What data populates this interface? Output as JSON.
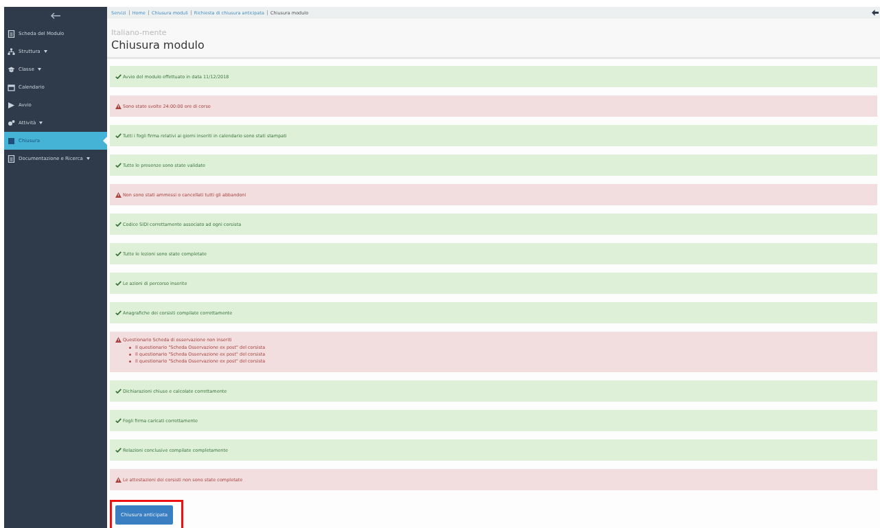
{
  "sidebar": {
    "items": [
      {
        "label": "Scheda del Modulo",
        "submenu": false,
        "selected": false
      },
      {
        "label": "Struttura",
        "submenu": true,
        "selected": false
      },
      {
        "label": "Classe",
        "submenu": true,
        "selected": false
      },
      {
        "label": "Calendario",
        "submenu": false,
        "selected": false
      },
      {
        "label": "Avvio",
        "submenu": false,
        "selected": false
      },
      {
        "label": "Attività",
        "submenu": true,
        "selected": false
      },
      {
        "label": "Chiusura",
        "submenu": false,
        "selected": true
      },
      {
        "label": "Documentazione e Ricerca",
        "submenu": true,
        "selected": false
      }
    ]
  },
  "breadcrumb": [
    {
      "label": "Servizi",
      "link": true
    },
    {
      "label": "Home",
      "link": true
    },
    {
      "label": "Chiusura moduli",
      "link": true
    },
    {
      "label": "Richiesta di chiusura anticipata",
      "link": true
    },
    {
      "label": "Chiusura modulo",
      "link": false
    }
  ],
  "header": {
    "subtitle": "Italiano-mente",
    "title": "Chiusura modulo"
  },
  "checks": [
    {
      "kind": "ok",
      "text": "Avvio del modulo effettuato in data 11/12/2018"
    },
    {
      "kind": "warning",
      "text": "Sono state svolte 24:00:00 ore di corso"
    },
    {
      "kind": "ok",
      "text": "Tutti i fogli firma relativi ai giorni inseriti in calendario sono stati stampati"
    },
    {
      "kind": "ok",
      "text": "Tutte le presenze sono state validate"
    },
    {
      "kind": "warning",
      "text": "Non sono stati ammessi o cancellati tutti gli abbandoni"
    },
    {
      "kind": "ok",
      "text": "Codice SIDI correttamente associato ad ogni corsista"
    },
    {
      "kind": "ok",
      "text": "Tutte le lezioni sono state completate"
    },
    {
      "kind": "ok",
      "text": "Le azioni di percorso inserite"
    },
    {
      "kind": "ok",
      "text": "Anagrafiche dei corsisti compilate correttamente"
    },
    {
      "kind": "warning",
      "text": "Questionario Scheda di osservazione non inseriti",
      "details": [
        "Il questionario \"Scheda Osservazione ex post\" del corsista",
        "Il questionario \"Scheda Osservazione ex post\" del corsista",
        "Il questionario \"Scheda Osservazione ex post\" del corsista"
      ]
    },
    {
      "kind": "ok",
      "text": "Dichiarazioni chiuse e calcolate correttamente"
    },
    {
      "kind": "ok",
      "text": "Fogli firma caricati correttamente"
    },
    {
      "kind": "ok",
      "text": "Relazioni conclusive compilate completamente"
    },
    {
      "kind": "warning",
      "text": "Le attestazioni dei corsisti non sono state completate"
    }
  ],
  "action_button": {
    "label": "Chiusura anticipata",
    "highlighted": true
  }
}
